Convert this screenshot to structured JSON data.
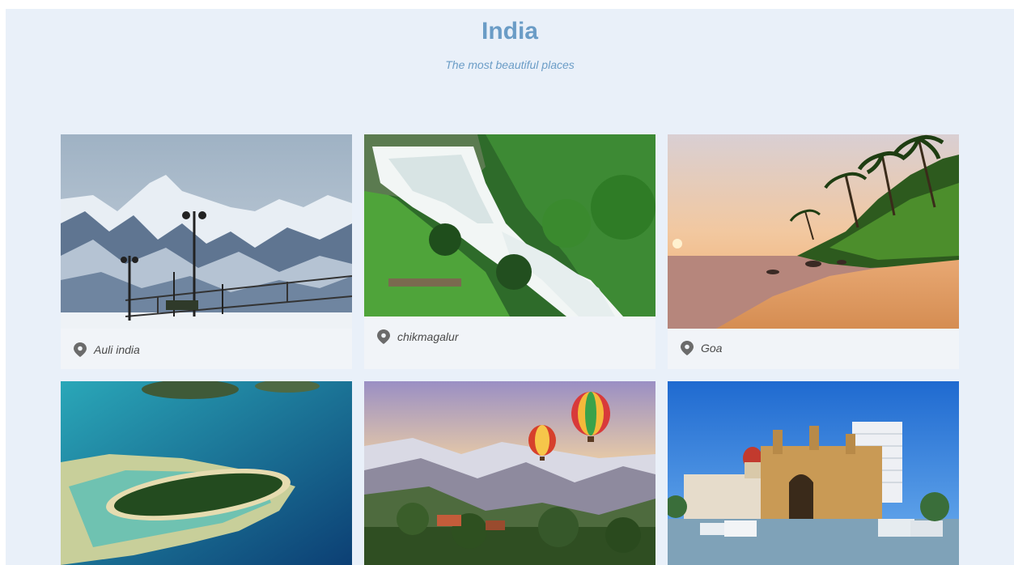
{
  "header": {
    "title": "India",
    "subtitle": "The most beautiful places"
  },
  "places": [
    {
      "name": "Auli india",
      "image": "snowy-mountains-photo"
    },
    {
      "name": "chikmagalur",
      "image": "waterfall-photo"
    },
    {
      "name": "Goa",
      "image": "beach-sunset-photo"
    },
    {
      "name": "",
      "image": "island-aerial-photo"
    },
    {
      "name": "",
      "image": "hot-air-balloons-photo"
    },
    {
      "name": "",
      "image": "gateway-of-india-photo"
    }
  ],
  "colors": {
    "background": "#e9f0f9",
    "title": "#6a9cc6",
    "card": "#f1f4f8",
    "pin": "#6b6b6b"
  },
  "icons": {
    "location": "map-pin-icon"
  }
}
